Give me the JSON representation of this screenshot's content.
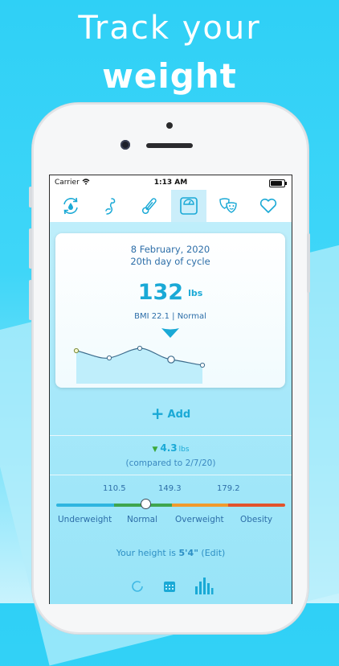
{
  "headline": {
    "line1": "Track your",
    "line2": "weight"
  },
  "status_bar": {
    "carrier": "Carrier",
    "time": "1:13 AM"
  },
  "tabs": [
    {
      "icon": "refresh-drop-icon",
      "active": false
    },
    {
      "icon": "fetus-icon",
      "active": false
    },
    {
      "icon": "thermometer-icon",
      "active": false
    },
    {
      "icon": "scale-icon",
      "active": true
    },
    {
      "icon": "theater-masks-icon",
      "active": false
    },
    {
      "icon": "heart-icon",
      "active": false
    }
  ],
  "card": {
    "date": "8 February, 2020",
    "cycle_day": "20th day of cycle",
    "weight_value": "132",
    "weight_unit": "lbs",
    "bmi_text": "BMI 22.1 | Normal"
  },
  "add_label": "Add",
  "change": {
    "value": "4.3",
    "unit": "lbs",
    "compared": "(compared to 2/7/20)"
  },
  "bmi_scale": {
    "ticks": [
      "110.5",
      "149.3",
      "179.2"
    ],
    "categories": [
      "Underweight",
      "Normal",
      "Overweight",
      "Obesity"
    ],
    "colors": [
      "#2fb5e0",
      "#3ea64e",
      "#f19a2b",
      "#e2532c"
    ],
    "marker_fraction": 0.39
  },
  "height": {
    "prefix": "Your height is",
    "value": "5'4\"",
    "edit": "(Edit)"
  },
  "bottom_icons": [
    "ring-icon",
    "calendar-icon",
    "bar-chart-icon"
  ],
  "colors": {
    "accent": "#1aa9d6",
    "text": "#2d6ea8"
  }
}
